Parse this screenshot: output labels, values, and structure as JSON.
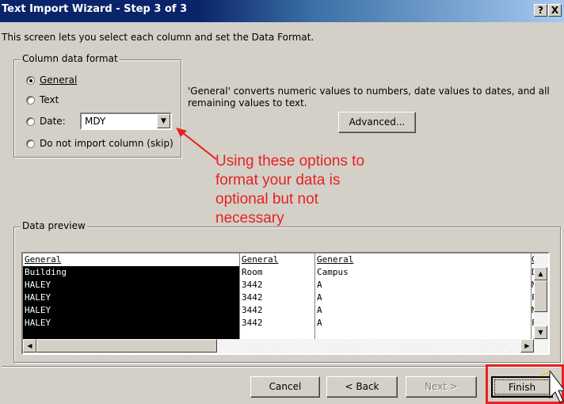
{
  "window": {
    "title": "Text Import Wizard - Step 3 of 3",
    "help_label": "?",
    "close_label": "X"
  },
  "intro_text": "This screen lets you select each column and set the Data Format.",
  "column_format": {
    "legend": "Column data format",
    "options": {
      "general": "General",
      "text": "Text",
      "date": "Date:",
      "skip": "Do not import column (skip)"
    },
    "selected": "general",
    "date_format_value": "MDY"
  },
  "description": "'General' converts numeric values to numbers, date values to dates, and all remaining values to text.",
  "advanced_button": "Advanced...",
  "annotation": {
    "lines": [
      "Using these options to",
      "format your data is",
      "optional but not",
      "necessary"
    ],
    "color": "#e52222"
  },
  "preview": {
    "legend": "Data preview",
    "columns": [
      {
        "header": "General",
        "cells": [
          "Building",
          "HALEY",
          "HALEY",
          "HALEY",
          "HALEY"
        ]
      },
      {
        "header": "General",
        "cells": [
          "Room",
          "3442",
          "3442",
          "3442",
          "3442"
        ]
      },
      {
        "header": "General",
        "cells": [
          "Campus",
          "A",
          "A",
          "A",
          "A"
        ]
      },
      {
        "header": "G",
        "cells": [
          "D",
          "M",
          "F",
          "M",
          "F"
        ]
      }
    ]
  },
  "buttons": {
    "cancel": "Cancel",
    "back": "< Back",
    "next": "Next >",
    "finish": "Finish"
  },
  "colors": {
    "title_bar": "#0a246a",
    "dialog_bg": "#d4d0c8",
    "annotation_red": "#e52222"
  }
}
